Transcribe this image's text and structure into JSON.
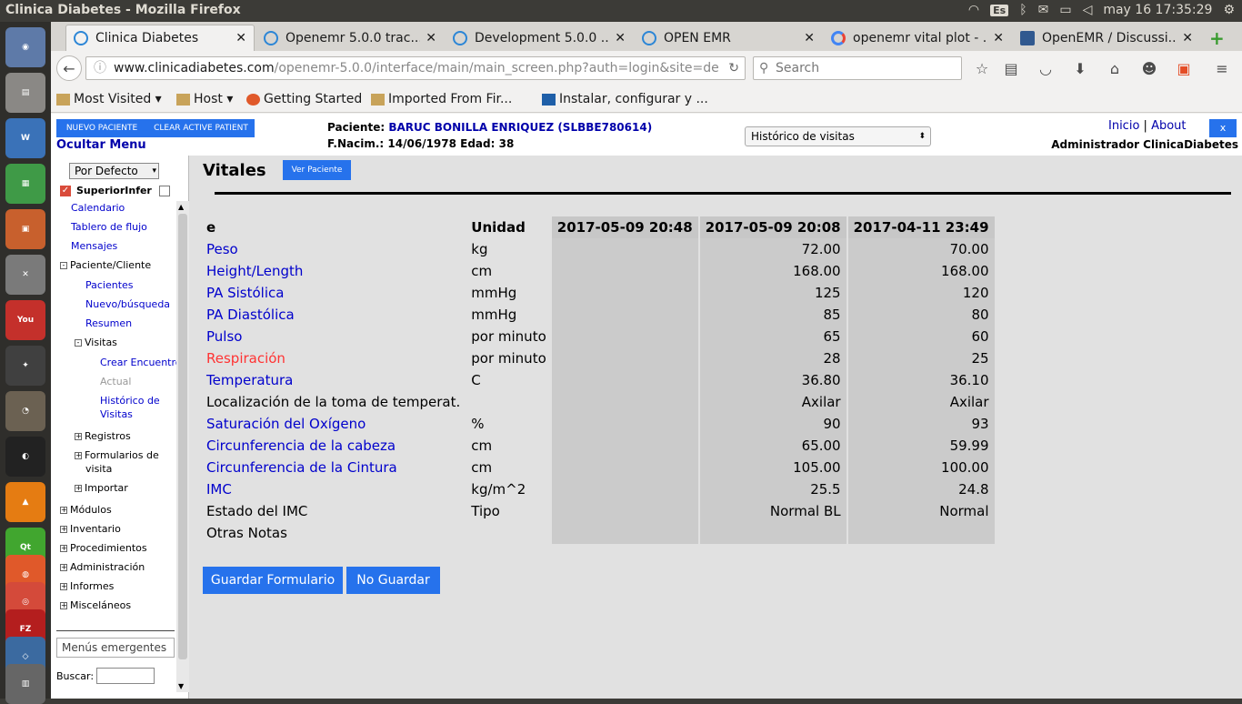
{
  "os": {
    "window_title": "Clinica Diabetes - Mozilla Firefox",
    "keyboard": "Es",
    "clock": "may 16 17:35:29",
    "launcher": [
      "Ubuntu",
      "Files",
      "Writer",
      "Calc",
      "Impress",
      "Settings",
      "YouTube",
      "Inkscape",
      "GIMP",
      "Spotify",
      "VLC",
      "Qt",
      "Firefox",
      "Chrome",
      "FileZilla",
      "Network",
      "Workspaces"
    ]
  },
  "browser": {
    "tabs": [
      {
        "title": "Clinica Diabetes",
        "active": true
      },
      {
        "title": "Openemr 5.0.0 trac..."
      },
      {
        "title": "Development 5.0.0 ..."
      },
      {
        "title": "OPEN EMR"
      },
      {
        "title": "openemr vital plot - ..."
      },
      {
        "title": "OpenEMR / Discussi..."
      }
    ],
    "url_domain": "www.clinicadiabetes.com",
    "url_path": "/openemr-5.0.0/interface/main/main_screen.php?auth=login&site=de",
    "search_placeholder": "Search",
    "bookmarks": [
      "Most Visited",
      "Host",
      "Getting Started",
      "Imported From Fir...",
      "Instalar, configurar y ..."
    ]
  },
  "header": {
    "new_patient": "NUEVO PACIENTE",
    "clear_patient": "CLEAR ACTIVE PATIENT",
    "hide_menu": "Ocultar Menu",
    "patient_label": "Paciente:",
    "patient_name": "BARUC BONILLA ENRIQUEZ (SLBBE780614)",
    "dob_line": "F.Nacim.: 14/06/1978 Edad: 38",
    "history_select": "Histórico de visitas",
    "inicio": "Inicio",
    "sep": "|",
    "about": "About",
    "close": "x",
    "admin": "Administrador ClinicaDiabetes"
  },
  "leftnav": {
    "default_select": "Por Defecto",
    "checkbox_label": "SuperiorInfer",
    "items": [
      {
        "label": "Calendario",
        "level": 0,
        "link": true
      },
      {
        "label": "Tablero de flujo",
        "level": 0,
        "link": true
      },
      {
        "label": "Mensajes",
        "level": 0,
        "link": true
      },
      {
        "label": "Paciente/Cliente",
        "level": 0,
        "toggle": "-"
      },
      {
        "label": "Pacientes",
        "level": 1,
        "link": true
      },
      {
        "label": "Nuevo/búsqueda",
        "level": 1,
        "link": true
      },
      {
        "label": "Resumen",
        "level": 1,
        "link": true
      },
      {
        "label": "Visitas",
        "level": 1,
        "toggle": "-"
      },
      {
        "label": "Crear Encuentro",
        "level": 2,
        "link": true
      },
      {
        "label": "Actual",
        "level": 2,
        "grey": true
      },
      {
        "label": "Histórico de",
        "level": 2,
        "link": true
      },
      {
        "label": "Visitas",
        "level": 2,
        "link": true
      },
      {
        "label": "Registros",
        "level": 1,
        "toggle": "+"
      },
      {
        "label": "Formularios de",
        "level": 1,
        "toggle": "+"
      },
      {
        "label": "visita",
        "level": 1
      },
      {
        "label": "Importar",
        "level": 1,
        "toggle": "+"
      },
      {
        "label": "Módulos",
        "level": 0,
        "toggle": "+"
      },
      {
        "label": "Inventario",
        "level": 0,
        "toggle": "+"
      },
      {
        "label": "Procedimientos",
        "level": 0,
        "toggle": "+"
      },
      {
        "label": "Administración",
        "level": 0,
        "toggle": "+"
      },
      {
        "label": "Informes",
        "level": 0,
        "toggle": "+"
      },
      {
        "label": "Misceláneos",
        "level": 0,
        "toggle": "+"
      }
    ],
    "popups": "Menús emergentes",
    "search_label": "Buscar:"
  },
  "vitals": {
    "title": "Vitales",
    "view_patient": "Ver Paciente",
    "col_label": "e",
    "col_unit": "Unidad",
    "dates": [
      "2017-05-09 20:48",
      "2017-05-09 20:08",
      "2017-04-11 23:49"
    ],
    "rows": [
      {
        "label": "Peso",
        "unit": "kg",
        "style": "link",
        "values": [
          "",
          "72.00",
          "70.00"
        ]
      },
      {
        "label": "Height/Length",
        "unit": "cm",
        "style": "link",
        "values": [
          "",
          "168.00",
          "168.00"
        ]
      },
      {
        "label": "PA Sistólica",
        "unit": "mmHg",
        "style": "link",
        "values": [
          "",
          "125",
          "120"
        ]
      },
      {
        "label": "PA Diastólica",
        "unit": "mmHg",
        "style": "link",
        "values": [
          "",
          "85",
          "80"
        ]
      },
      {
        "label": "Pulso",
        "unit": "por minuto",
        "style": "link",
        "values": [
          "",
          "65",
          "60"
        ]
      },
      {
        "label": "Respiración",
        "unit": "por minuto",
        "style": "red",
        "values": [
          "",
          "28",
          "25"
        ]
      },
      {
        "label": "Temperatura",
        "unit": "C",
        "style": "link",
        "values": [
          "",
          "36.80",
          "36.10"
        ]
      },
      {
        "label": "Localización de la toma de temperat.",
        "unit": "",
        "style": "plain",
        "values": [
          "",
          "Axilar",
          "Axilar"
        ]
      },
      {
        "label": "Saturación del Oxígeno",
        "unit": "%",
        "style": "link",
        "values": [
          "",
          "90",
          "93"
        ]
      },
      {
        "label": "Circunferencia de la cabeza",
        "unit": "cm",
        "style": "link",
        "values": [
          "",
          "65.00",
          "59.99"
        ]
      },
      {
        "label": "Circunferencia de la Cintura",
        "unit": "cm",
        "style": "link",
        "values": [
          "",
          "105.00",
          "100.00"
        ]
      },
      {
        "label": "IMC",
        "unit": "kg/m^2",
        "style": "link",
        "values": [
          "",
          "25.5",
          "24.8"
        ]
      },
      {
        "label": "Estado del IMC",
        "unit": "Tipo",
        "style": "plain",
        "values": [
          "",
          "Normal BL",
          "Normal"
        ]
      },
      {
        "label": "Otras Notas",
        "unit": "",
        "style": "plain",
        "values": [
          "",
          "",
          ""
        ]
      }
    ],
    "save": "Guardar Formulario",
    "nosave": "No Guardar"
  },
  "colors": {
    "accent": "#2672ec",
    "link": "#0000cc",
    "alert": "#ff3333"
  }
}
